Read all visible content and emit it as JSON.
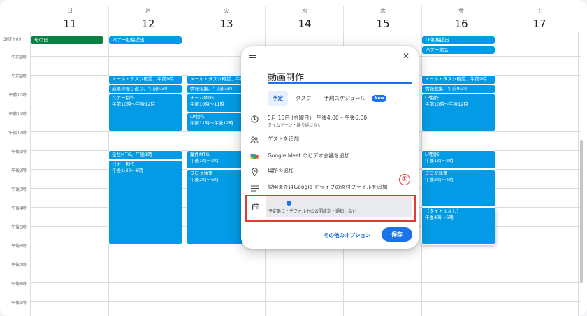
{
  "timezone": "GMT+09",
  "days": [
    {
      "dow": "日",
      "num": "11"
    },
    {
      "dow": "月",
      "num": "12"
    },
    {
      "dow": "火",
      "num": "13"
    },
    {
      "dow": "水",
      "num": "14"
    },
    {
      "dow": "木",
      "num": "15"
    },
    {
      "dow": "金",
      "num": "16"
    },
    {
      "dow": "土",
      "num": "17"
    }
  ],
  "time_labels": [
    "午前8時",
    "午前9時",
    "午前10時",
    "午前11時",
    "午後12時",
    "午後1時",
    "午後2時",
    "午後3時",
    "午後4時",
    "午後5時",
    "午後6時",
    "午後7時",
    "午後8時",
    "午後9時"
  ],
  "allday_events": {
    "sun_mothers_day": "母の日",
    "mon_banner_draft": "バナー初稿提出",
    "fri_lp_draft": "LP初稿提出",
    "fri_banner_delivery": "バナー納品"
  },
  "events": {
    "mon_mail": "メール・タスク確認、午前9時",
    "mon_review": "成果の振り返り、午前9:30",
    "mon_banner_title": "バナー制作",
    "mon_banner_time": "午前10時～午後12時",
    "mon_allhands": "全社MTG、午後1時",
    "mon_banner2_title": "バナー制作",
    "mon_banner2_time": "午後1:30～6時",
    "tue_mail": "メール・タスク確認、午前9時",
    "tue_info": "情報収集、午前9:30",
    "tue_team_title": "チームMTG",
    "tue_team_time": "午前10時～11時",
    "tue_lp_title": "LP制作",
    "tue_lp_time": "午前11時～午後12時",
    "tue_case_title": "案件MTG",
    "tue_case_time": "午後1時～2時",
    "tue_blog_title": "ブログ執筆",
    "tue_blog_time": "午後2時～6時",
    "fri_mail": "メール・タスク確認、午前9時",
    "fri_info": "情報収集、午前9:30",
    "fri_lp_title": "LP制作",
    "fri_lp_time": "午前10時～午後12時",
    "fri_lp2_title": "LP制作",
    "fri_lp2_time": "午後1時～2時",
    "fri_blog_title": "ブログ執筆",
    "fri_blog_time": "午後2時～4時",
    "fri_untitled_title": "（タイトルなし）",
    "fri_untitled_time": "午後4時～6時"
  },
  "dialog": {
    "title_value": "動画制作",
    "tabs": [
      "予定",
      "タスク",
      "予約スケジュール"
    ],
    "new_badge": "New",
    "datetime": "5月 16日 (金曜日)　午後4:00 – 午後6:00",
    "timezone_repeat": "タイムゾーン・繰り返さない",
    "add_guests": "ゲストを追加",
    "add_meet": "Google Meet のビデオ会議を追加",
    "add_location": "場所を追加",
    "add_description": "説明またはGoogle ドライブの添付ファイルを追加",
    "status_text": "予定あり・デフォルトの公開設定・通知しない",
    "more_options": "その他のオプション",
    "save": "保存",
    "annotation_number": "①"
  },
  "colors": {
    "event_blue": "#039be5",
    "event_green": "#0b8043",
    "accent": "#1a73e8",
    "highlight_red": "#e53935"
  }
}
